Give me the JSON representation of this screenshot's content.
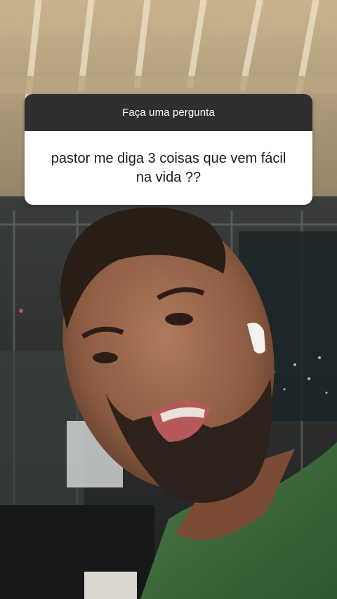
{
  "story": {
    "question_sticker": {
      "header": "Faça uma pergunta",
      "question": "pastor me diga 3 coisas que vem fácil na vida ??"
    }
  },
  "colors": {
    "sticker_header_bg": "#2f2f31",
    "sticker_body_bg": "#ffffff",
    "shirt_green": "#3f6a3c"
  }
}
